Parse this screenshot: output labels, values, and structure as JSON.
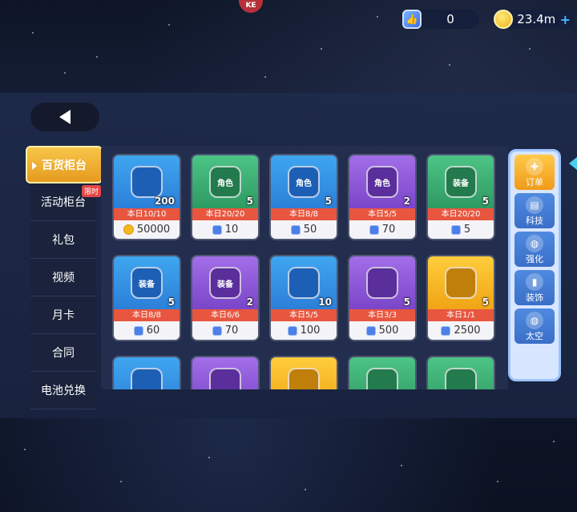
{
  "header": {
    "badge": "KE",
    "gem_amount": "0",
    "coin_amount": "23.4m",
    "add_symbol": "+"
  },
  "side_nav": [
    {
      "label": "百货柜台",
      "active": true
    },
    {
      "label": "活动柜台",
      "tag": "限时"
    },
    {
      "label": "礼包"
    },
    {
      "label": "视频"
    },
    {
      "label": "月卡"
    },
    {
      "label": "合同"
    },
    {
      "label": "电池兑换"
    }
  ],
  "cards": [
    {
      "color": "blue",
      "icon": "gem-pack-icon",
      "icon_text": "",
      "count": "200",
      "limit": "本日10/10",
      "currency": "coin",
      "price": "50000"
    },
    {
      "color": "green",
      "icon": "role-box-icon",
      "icon_text": "角色",
      "count": "5",
      "limit": "本日20/20",
      "currency": "gem",
      "price": "10"
    },
    {
      "color": "blue",
      "icon": "role-box-icon",
      "icon_text": "角色",
      "count": "5",
      "limit": "本日8/8",
      "currency": "gem",
      "price": "50"
    },
    {
      "color": "purple",
      "icon": "role-box-icon",
      "icon_text": "角色",
      "count": "2",
      "limit": "本日5/5",
      "currency": "gem",
      "price": "70"
    },
    {
      "color": "green",
      "icon": "equipment-box-icon",
      "icon_text": "装备",
      "count": "5",
      "limit": "本日20/20",
      "currency": "gem",
      "price": "5"
    },
    {
      "color": "blue",
      "icon": "equipment-box-icon",
      "icon_text": "装备",
      "count": "5",
      "limit": "本日8/8",
      "currency": "gem",
      "price": "60"
    },
    {
      "color": "purple",
      "icon": "equipment-box-icon",
      "icon_text": "装备",
      "count": "2",
      "limit": "本日6/6",
      "currency": "gem",
      "price": "70"
    },
    {
      "color": "blue",
      "icon": "blueprint-icon",
      "icon_text": "",
      "count": "10",
      "limit": "本日5/5",
      "currency": "gem",
      "price": "100"
    },
    {
      "color": "purple",
      "icon": "blueprint-icon",
      "icon_text": "",
      "count": "5",
      "limit": "本日3/3",
      "currency": "gem",
      "price": "500"
    },
    {
      "color": "gold",
      "icon": "blueprint-icon",
      "icon_text": "",
      "count": "5",
      "limit": "本日1/1",
      "currency": "gem",
      "price": "2500"
    },
    {
      "color": "blue",
      "icon": "item-icon",
      "icon_text": "",
      "count": "",
      "limit": "",
      "currency": "",
      "price": ""
    },
    {
      "color": "purple",
      "icon": "item-icon",
      "icon_text": "",
      "count": "",
      "limit": "",
      "currency": "",
      "price": ""
    },
    {
      "color": "gold",
      "icon": "item-icon",
      "icon_text": "",
      "count": "",
      "limit": "",
      "currency": "",
      "price": ""
    },
    {
      "color": "green",
      "icon": "item-icon",
      "icon_text": "",
      "count": "",
      "limit": "",
      "currency": "",
      "price": ""
    },
    {
      "color": "green",
      "icon": "item-icon",
      "icon_text": "",
      "count": "",
      "limit": "",
      "currency": "",
      "price": ""
    }
  ],
  "right_rail": [
    {
      "label": "订单",
      "icon": "order-icon",
      "active": true
    },
    {
      "label": "科技",
      "icon": "tech-icon"
    },
    {
      "label": "强化",
      "icon": "planet-icon"
    },
    {
      "label": "装饰",
      "icon": "paint-roller-icon"
    },
    {
      "label": "太空",
      "icon": "planet-icon"
    }
  ]
}
